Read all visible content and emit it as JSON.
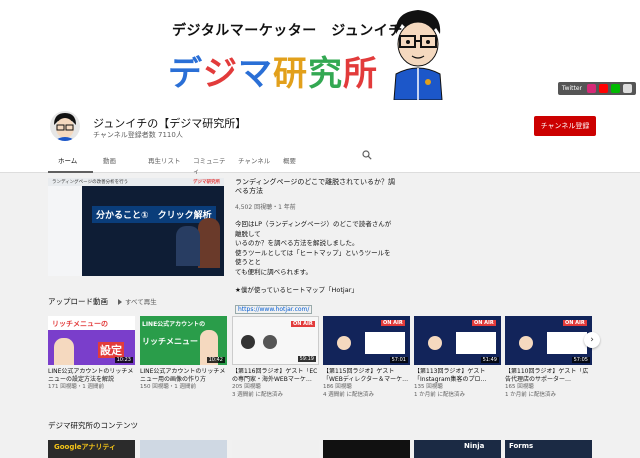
{
  "banner": {
    "tagline": "デジタルマーケッター　ジュンイチの",
    "title_chars": [
      "デ",
      "ジ",
      "マ",
      "研",
      "究",
      "所"
    ],
    "links_label": "Twitter"
  },
  "channel": {
    "name": "ジュンイチの【デジマ研究所】",
    "subscribers": "チャンネル登録者数 7110人",
    "subscribe_label": "チャンネル登録",
    "tabs": [
      "ホーム",
      "動画",
      "再生リスト",
      "コミュニティ",
      "チャンネル",
      "概要"
    ]
  },
  "featured": {
    "thumb_title": "ランディングページの改善分析を行う",
    "thumb_logo": "デジマ研究所",
    "thumb_banner": "分かること①　クリック解析",
    "title": "ランディングページのどこで離脱されているか？調べる方法",
    "meta": "4,502 回視聴・1 年前",
    "desc": [
      "今回はLP（ランディングページ）のどこで読者さんが離脱して",
      "いるのか？を調べる方法を解説しました。",
      "使うツールとしては「ヒートマップ」というツールを使うとと",
      "ても便利に調べられます。",
      "",
      "★僕が使っているヒートマップ「Hotjar」"
    ],
    "link": "https://www.hotjar.com/",
    "more": "詳細"
  },
  "uploads": {
    "title": "アップロード動画",
    "play_all": "すべて再生",
    "videos": [
      {
        "thumb": "リッチメニューの",
        "thumb2": "設定",
        "duration": "10:23",
        "title": "LINE公式アカウントのリッチメニューの設定方法を解説",
        "meta1": "171 回視聴・1 週間前",
        "meta2": ""
      },
      {
        "thumb": "LINE公式アカウントの",
        "thumb2": "リッチメニュー",
        "duration": "10:42",
        "title": "LINE公式アカウントのリッチメニュー用の画像の作り方",
        "meta1": "150 回視聴・1 週間前",
        "meta2": ""
      },
      {
        "thumb": "ON AIR",
        "thumb2": "",
        "duration": "59:19",
        "title": "【第116回ラジオ】ゲスト「ECの専門家・海外WEBマーケ…",
        "meta1": "205 回視聴",
        "meta2": "3 週間前 に配信済み"
      },
      {
        "thumb": "ON AIR",
        "thumb2": "",
        "duration": "57:01",
        "title": "【第115回ラジオ】ゲスト「WEBディレクター＆マーケ…",
        "meta1": "186 回視聴",
        "meta2": "4 週間前 に配信済み"
      },
      {
        "thumb": "ON AIR",
        "thumb2": "",
        "duration": "51:49",
        "title": "【第113回ラジオ】ゲスト「Instagram集客のプロ…",
        "meta1": "135 回視聴",
        "meta2": "1 か月前 に配信済み"
      },
      {
        "thumb": "ON AIR",
        "thumb2": "",
        "duration": "57:05",
        "title": "【第110回ラジオ】ゲスト「広告代理店のサポーター…",
        "meta1": "165 回視聴",
        "meta2": "1 か月前 に配信済み"
      }
    ]
  },
  "contents": {
    "title": "デジマ研究所のコンテンツ",
    "thumbs": [
      "Googleアナリティ",
      "",
      "",
      "",
      "Ninja",
      "Forms"
    ]
  },
  "colors": {
    "subscribe": "#cc0000",
    "link": "#065fd4"
  }
}
